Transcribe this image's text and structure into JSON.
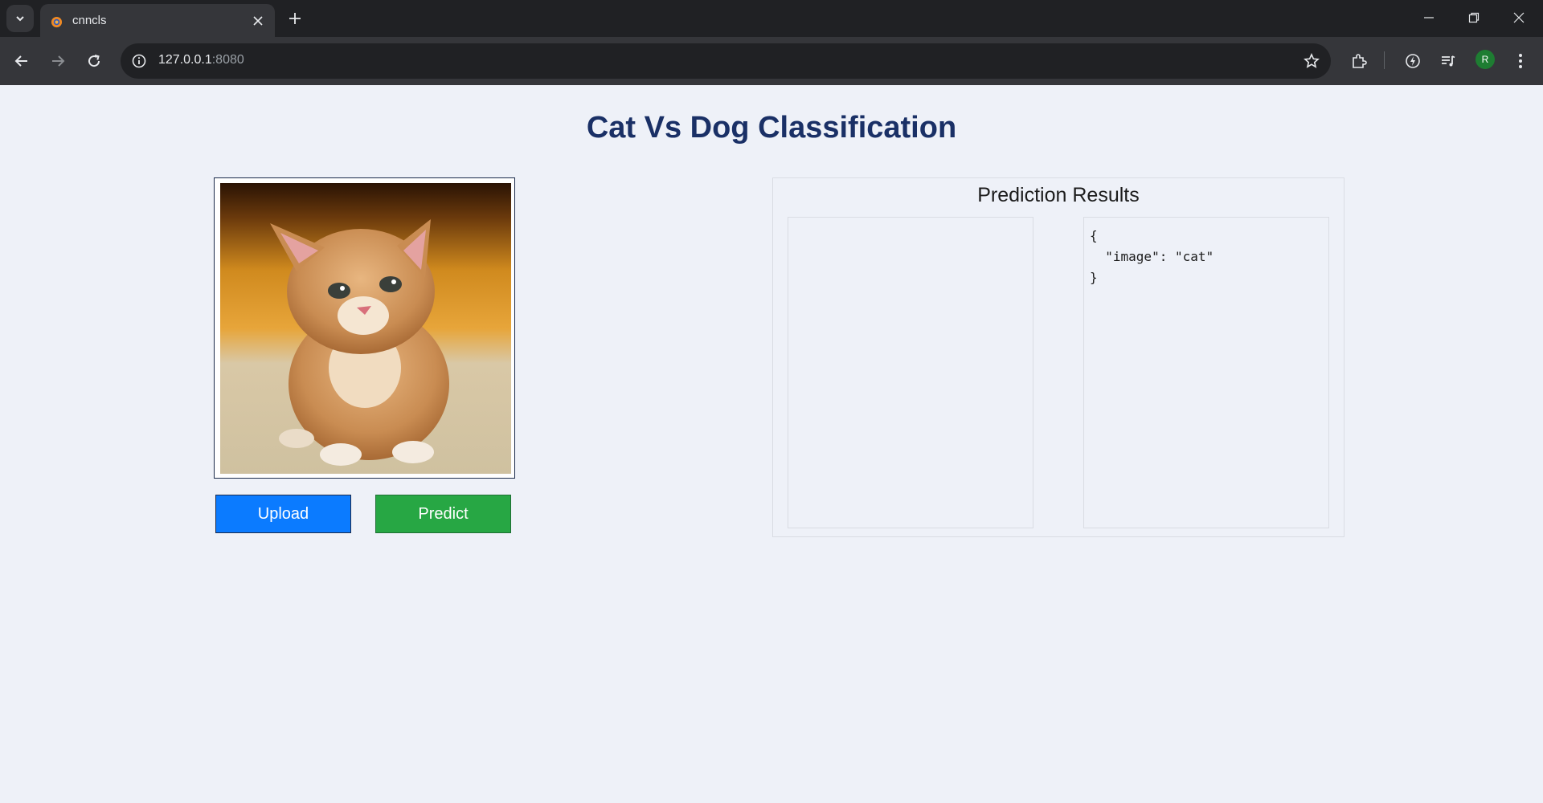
{
  "browser": {
    "tab_title": "cnncls",
    "url_host": "127.0.0.1",
    "url_port": ":8080",
    "profile_initial": "R"
  },
  "page": {
    "title": "Cat Vs Dog Classification",
    "upload_label": "Upload",
    "predict_label": "Predict",
    "results_title": "Prediction Results",
    "prediction_json": "{\n  \"image\": \"cat\"\n}"
  },
  "colors": {
    "title": "#1a3066",
    "upload_button": "#0b7bff",
    "predict_button": "#27a744",
    "page_background": "#eef1f8"
  },
  "icons": [
    "tab-list-icon",
    "favicon-icon",
    "close-icon",
    "plus-icon",
    "minimize-icon",
    "restore-icon",
    "window-close-icon",
    "back-icon",
    "forward-icon",
    "reload-icon",
    "info-icon",
    "star-icon",
    "extensions-icon",
    "performance-icon",
    "media-icon",
    "menu-icon"
  ]
}
